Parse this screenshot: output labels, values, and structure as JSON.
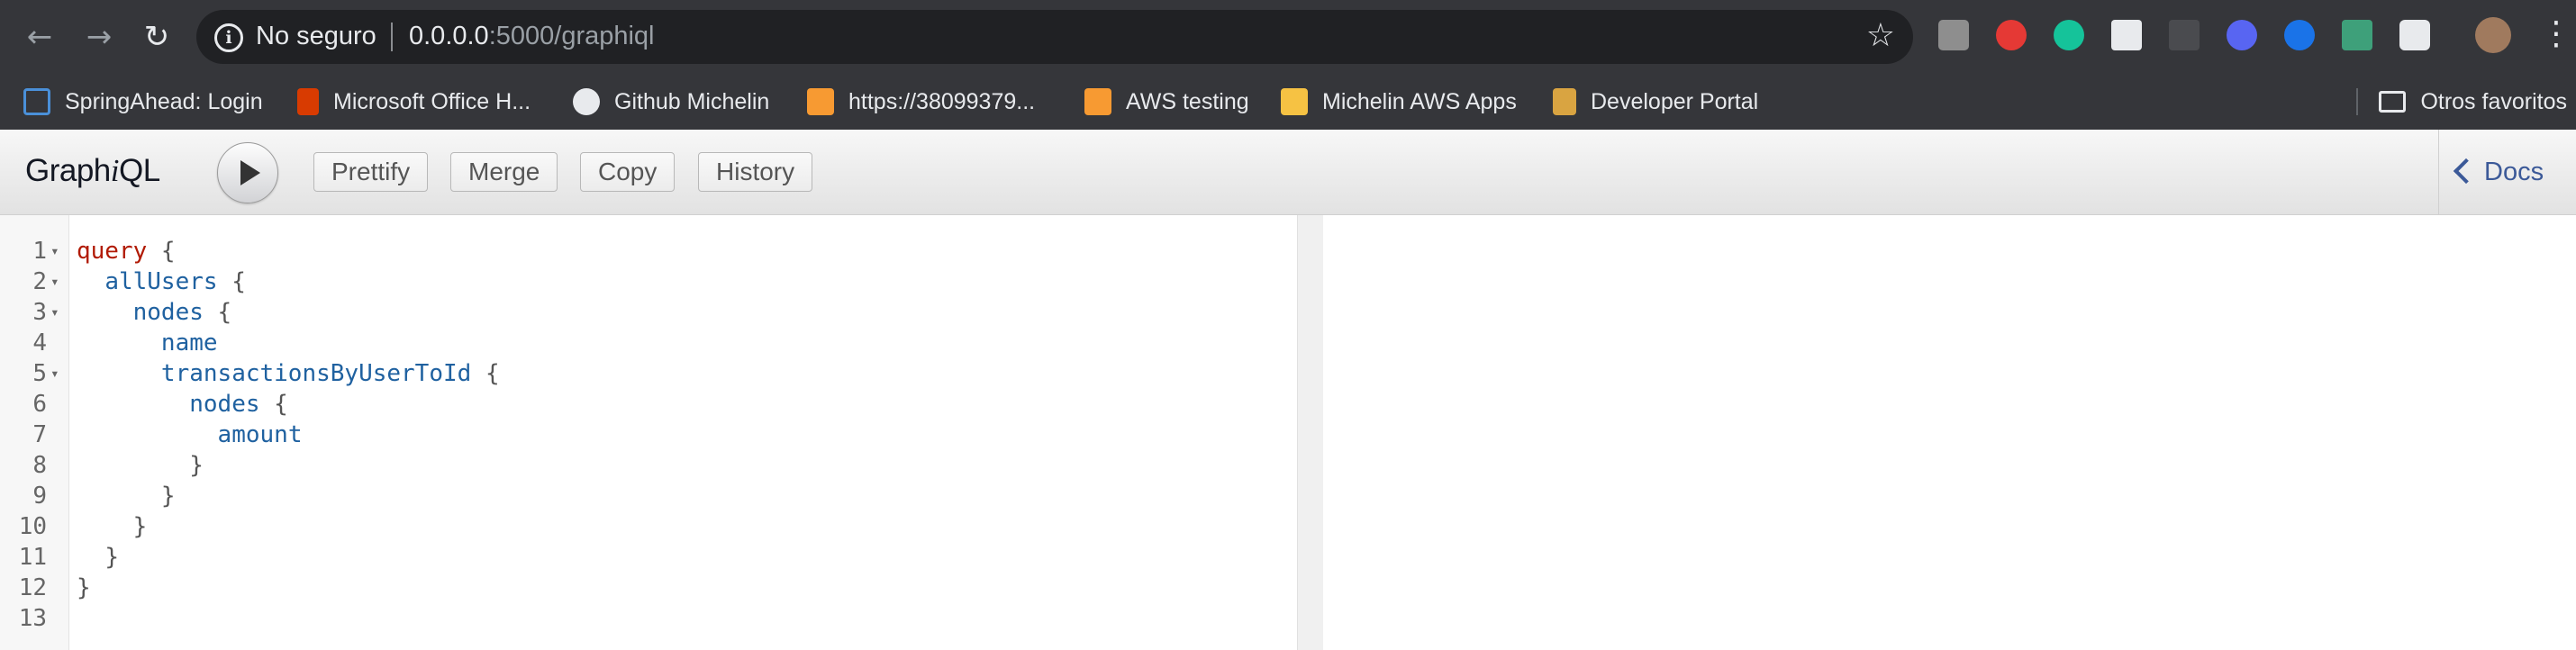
{
  "browser": {
    "security_label": "No seguro",
    "url_host": "0.0.0.0",
    "url_path": ":5000/graphiql",
    "back_icon": "arrow-left-icon",
    "forward_icon": "arrow-right-icon",
    "reload_icon": "reload-icon",
    "extensions": [
      "comment-extension",
      "adblock-extension",
      "grammarly-extension",
      "screenshot-extension",
      "flow-extension",
      "task-extension",
      "onepassword-extension",
      "pin-extension",
      "reader-extension",
      "profile-avatar"
    ]
  },
  "bookmarks": {
    "items": [
      {
        "label": "SpringAhead: Login",
        "icon": "grid-icon",
        "color": "#4a90d9"
      },
      {
        "label": "Microsoft Office H...",
        "icon": "office-icon",
        "color": "#d83b01"
      },
      {
        "label": "Github Michelin",
        "icon": "github-icon",
        "color": "#ffffff"
      },
      {
        "label": "https://38099379...",
        "icon": "aws-box-icon",
        "color": "#f79a32"
      },
      {
        "label": "AWS testing",
        "icon": "aws-box-icon",
        "color": "#f79a32"
      },
      {
        "label": "Michelin AWS Apps",
        "icon": "aws-apps-icon",
        "color": "#f6c243"
      },
      {
        "label": "Developer Portal",
        "icon": "portal-icon",
        "color": "#d9a441"
      }
    ],
    "other_label": "Otros favoritos"
  },
  "graphiql": {
    "title_prefix": "Graph",
    "title_italic": "i",
    "title_suffix": "QL",
    "buttons": {
      "prettify": "Prettify",
      "merge": "Merge",
      "copy": "Copy",
      "history": "History"
    },
    "docs_label": "Docs"
  },
  "editor": {
    "lines": [
      {
        "n": "1",
        "indent": "",
        "fold": true,
        "tokens": [
          {
            "t": "query",
            "c": "kw"
          },
          {
            "t": " {",
            "c": "punc"
          }
        ]
      },
      {
        "n": "2",
        "indent": "  ",
        "fold": true,
        "tokens": [
          {
            "t": "allUsers",
            "c": "fld"
          },
          {
            "t": " {",
            "c": "punc"
          }
        ]
      },
      {
        "n": "3",
        "indent": "    ",
        "fold": true,
        "tokens": [
          {
            "t": "nodes",
            "c": "fld"
          },
          {
            "t": " {",
            "c": "punc"
          }
        ]
      },
      {
        "n": "4",
        "indent": "      ",
        "fold": false,
        "tokens": [
          {
            "t": "name",
            "c": "fld"
          }
        ]
      },
      {
        "n": "5",
        "indent": "      ",
        "fold": true,
        "tokens": [
          {
            "t": "transactionsByUserToId",
            "c": "fld"
          },
          {
            "t": " {",
            "c": "punc"
          }
        ]
      },
      {
        "n": "6",
        "indent": "        ",
        "fold": false,
        "tokens": [
          {
            "t": "nodes",
            "c": "fld"
          },
          {
            "t": " {",
            "c": "punc"
          }
        ]
      },
      {
        "n": "7",
        "indent": "          ",
        "fold": false,
        "tokens": [
          {
            "t": "amount",
            "c": "fld"
          }
        ]
      },
      {
        "n": "8",
        "indent": "        ",
        "fold": false,
        "tokens": [
          {
            "t": "}",
            "c": "punc"
          }
        ]
      },
      {
        "n": "9",
        "indent": "      ",
        "fold": false,
        "tokens": [
          {
            "t": "}",
            "c": "punc"
          }
        ]
      },
      {
        "n": "10",
        "indent": "    ",
        "fold": false,
        "tokens": [
          {
            "t": "}",
            "c": "punc"
          }
        ]
      },
      {
        "n": "11",
        "indent": "  ",
        "fold": false,
        "tokens": [
          {
            "t": "}",
            "c": "punc"
          }
        ]
      },
      {
        "n": "12",
        "indent": "",
        "fold": false,
        "tokens": [
          {
            "t": "}",
            "c": "punc"
          }
        ]
      },
      {
        "n": "13",
        "indent": "",
        "fold": false,
        "tokens": []
      }
    ]
  },
  "colors": {
    "keyword": "#b11a04",
    "field": "#1f61a0",
    "docs_link": "#3b5998"
  }
}
